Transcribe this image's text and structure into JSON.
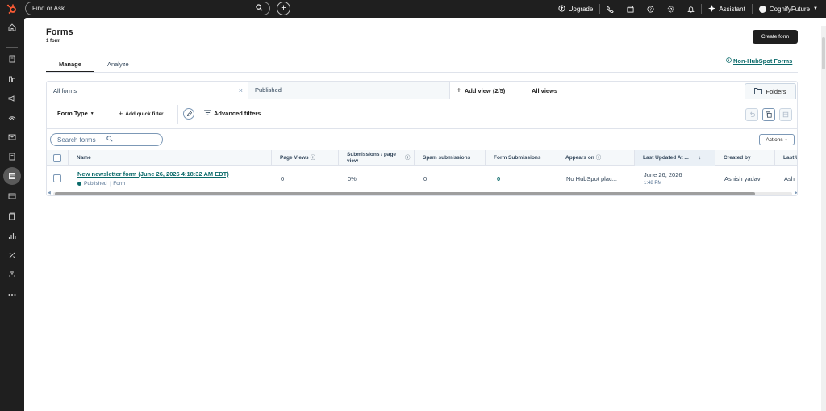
{
  "topbar": {
    "search_placeholder": "Find or Ask",
    "upgrade": "Upgrade",
    "assistant": "Assistant",
    "account": "CognifyFuture"
  },
  "page": {
    "title": "Forms",
    "subtitle": "1 form",
    "create_button": "Create form",
    "tabs": [
      "Manage",
      "Analyze"
    ],
    "non_hubspot_link": "Non-HubSpot Forms"
  },
  "views": {
    "all_forms": "All forms",
    "published": "Published",
    "add_view": "Add view (2/5)",
    "all_views": "All views",
    "folders": "Folders"
  },
  "filters": {
    "form_type": "Form Type",
    "add_quick_filter": "Add quick filter",
    "advanced_filters": "Advanced filters",
    "search_placeholder": "Search forms",
    "actions": "Actions"
  },
  "table": {
    "columns": [
      "Name",
      "Page Views",
      "Submissions / page view",
      "Spam submissions",
      "Form Submissions",
      "Appears on",
      "Last Updated At ...",
      "Created by",
      "Last U"
    ],
    "rows": [
      {
        "name": "New newsletter form (June 26, 2026 4:18:32 AM EDT)",
        "status": "Published",
        "type": "Form",
        "page_views": "0",
        "submissions_per_view": "0%",
        "spam": "0",
        "form_submissions": "0",
        "appears_on": "No HubSpot plac...",
        "last_updated_date": "June 26, 2026",
        "last_updated_time": "1:48 PM",
        "created_by": "Ashish yadav",
        "last_updated_by": "Ash"
      }
    ]
  },
  "colors": {
    "chrome": "#1f1f1f",
    "link": "#0b6a6a",
    "text": "#33475b",
    "border": "#dfe3eb"
  }
}
